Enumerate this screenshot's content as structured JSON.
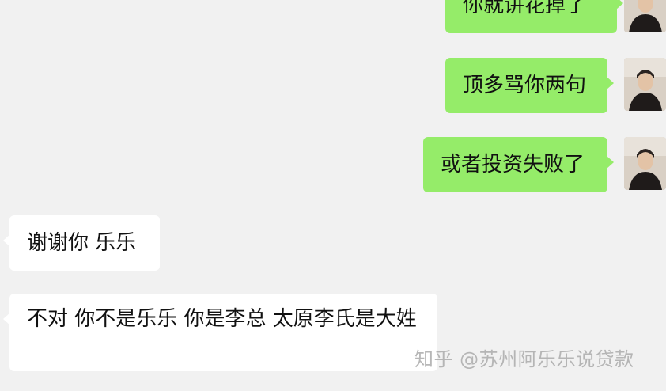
{
  "messages": [
    {
      "side": "outgoing",
      "text": "你就讲花掉了"
    },
    {
      "side": "outgoing",
      "text": "顶多骂你两句"
    },
    {
      "side": "outgoing",
      "text": "或者投资失败了"
    },
    {
      "side": "incoming",
      "text": "谢谢你 乐乐"
    },
    {
      "side": "incoming",
      "text": "不对 你不是乐乐 你是李总 太原李氏是大姓"
    }
  ],
  "watermark": "知乎 @苏州阿乐乐说贷款",
  "colors": {
    "background": "#f1f1f1",
    "outgoing_bubble": "#95ec69",
    "incoming_bubble": "#ffffff"
  }
}
